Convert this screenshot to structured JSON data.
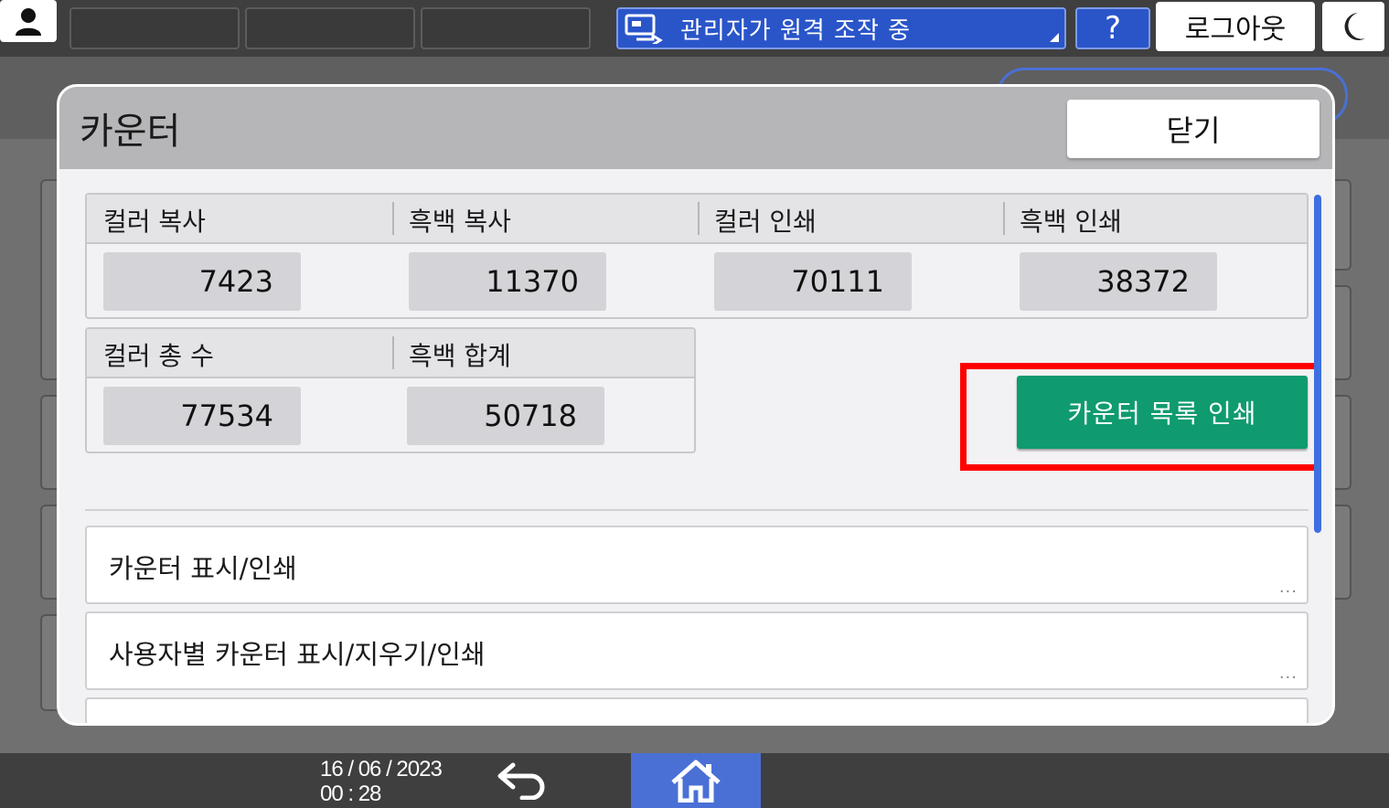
{
  "topbar": {
    "remote_status": "관리자가 원격 조작 중",
    "help_label": "?",
    "logout_label": "로그아웃"
  },
  "dialog": {
    "title": "카운터",
    "close_label": "닫기",
    "counters_top": {
      "headers": [
        "컬러 복사",
        "흑백 복사",
        "컬러 인쇄",
        "흑백 인쇄"
      ],
      "values": [
        "7423",
        "11370",
        "70111",
        "38372"
      ]
    },
    "counters_bottom": {
      "headers": [
        "컬러 총 수",
        "흑백 합계"
      ],
      "values": [
        "77534",
        "50718"
      ]
    },
    "print_list_label": "카운터 목록 인쇄",
    "menu_items": [
      {
        "label": "카운터 표시/인쇄",
        "more": "..."
      },
      {
        "label": "사용자별 카운터 표시/지우기/인쇄",
        "more": "..."
      }
    ]
  },
  "footer": {
    "date": "16 / 06 / 2023",
    "time": "00 : 28"
  },
  "colors": {
    "accent_blue": "#2a55c9",
    "home_blue": "#4a70d6",
    "print_green": "#0f9b6f",
    "highlight_red": "#ff0000"
  }
}
